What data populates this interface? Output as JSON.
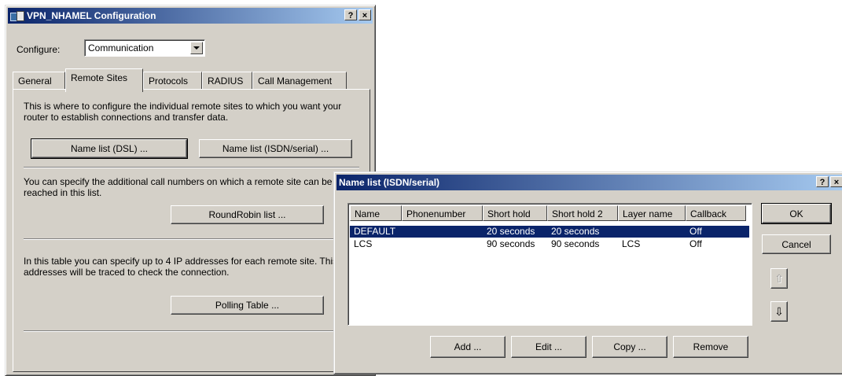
{
  "main_window": {
    "title": "VPN_NHAMEL Configuration",
    "help_btn": "?",
    "close_btn": "×",
    "configure_label": "Configure:",
    "configure_value": "Communication",
    "tabs": [
      {
        "label": "General"
      },
      {
        "label": "Remote Sites"
      },
      {
        "label": "Protocols"
      },
      {
        "label": "RADIUS"
      },
      {
        "label": "Call Management"
      }
    ],
    "text1": "This is where to configure the individual remote sites to which you want your router to establish connections and transfer data.",
    "btn_name_list_dsl": "Name list (DSL) ...",
    "btn_name_list_isdn": "Name list (ISDN/serial) ...",
    "text2": "You can specify the additional call numbers on which a remote site can be reached in this list.",
    "btn_roundrobin": "RoundRobin list ...",
    "text3": "In this table you can specify up to 4 IP addresses for each remote site. This IP addresses will be traced to check the connection.",
    "btn_polling": "Polling Table ..."
  },
  "dialog": {
    "title": "Name list (ISDN/serial)",
    "help_btn": "?",
    "close_btn": "×",
    "columns": [
      "Name",
      "Phonenumber",
      "Short hold",
      "Short hold 2",
      "Layer name",
      "Callback"
    ],
    "rows": [
      {
        "name": "DEFAULT",
        "phonenumber": "",
        "short_hold": "20 seconds",
        "short_hold_2": "20 seconds",
        "layer_name": "",
        "callback": "Off"
      },
      {
        "name": "LCS",
        "phonenumber": "",
        "short_hold": "90 seconds",
        "short_hold_2": "90 seconds",
        "layer_name": "LCS",
        "callback": "Off"
      }
    ],
    "ok_label": "OK",
    "cancel_label": "Cancel",
    "move_up_icon": "⇧",
    "move_down_icon": "⇩",
    "add_label": "Add ...",
    "edit_label": "Edit ...",
    "copy_label": "Copy ...",
    "remove_label": "Remove"
  }
}
